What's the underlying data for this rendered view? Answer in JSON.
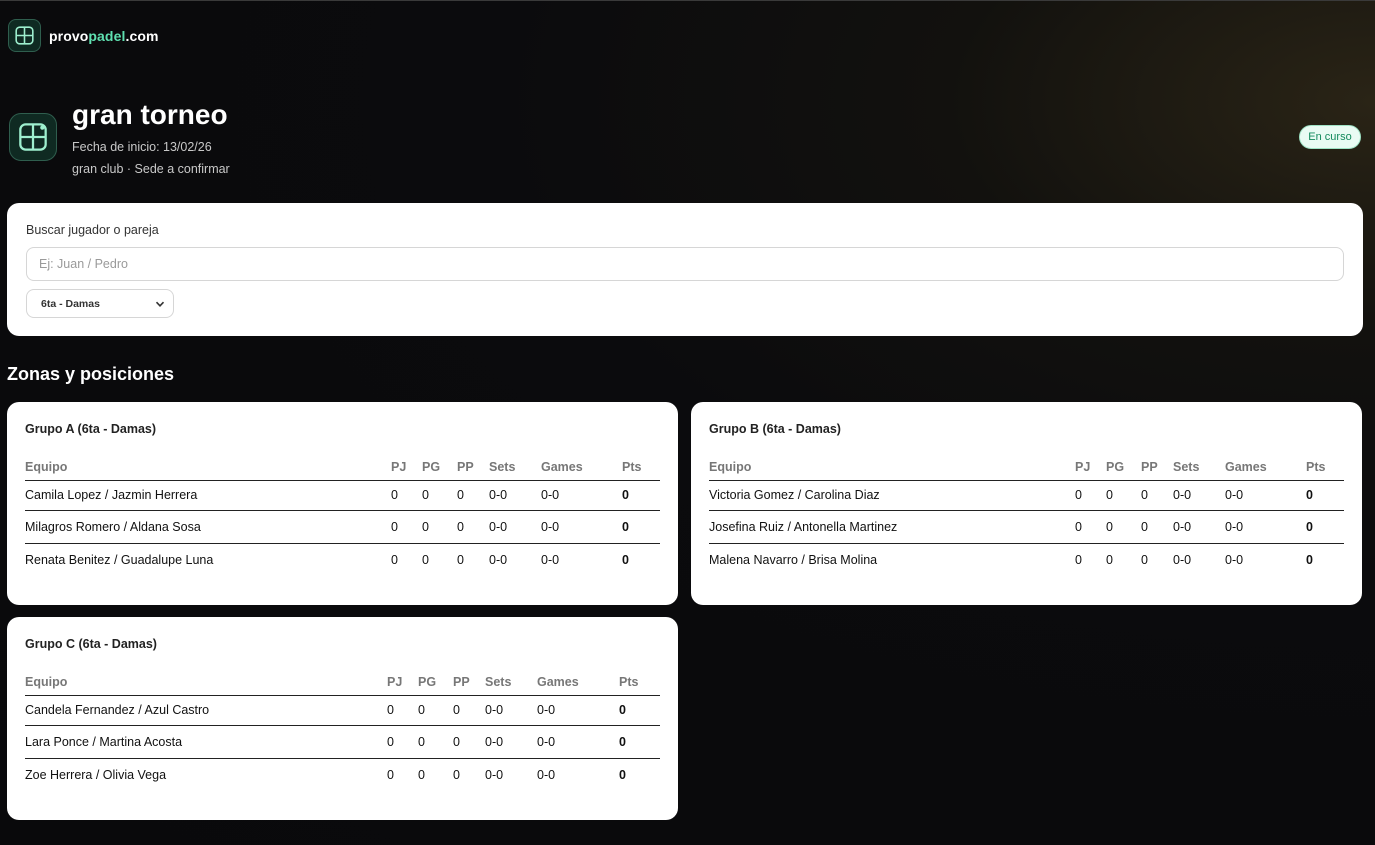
{
  "brand": {
    "prefix": "provo",
    "accent": "padel",
    "suffix": ".com"
  },
  "tournament": {
    "title": "gran torneo",
    "start_date": "Fecha de inicio: 13/02/26",
    "venue": "gran club · Sede a confirmar",
    "status": "En curso"
  },
  "filters": {
    "search_label": "Buscar jugador o pareja",
    "search_placeholder": "Ej: Juan / Pedro",
    "search_value": "",
    "category_selected": "6ta - Damas"
  },
  "section_title": "Zonas y posiciones",
  "table_headers": [
    "Equipo",
    "PJ",
    "PG",
    "PP",
    "Sets",
    "Games",
    "Pts"
  ],
  "groups": [
    {
      "title": "Grupo A (6ta - Damas)",
      "rows": [
        {
          "team": "Camila Lopez / Jazmin Herrera",
          "pj": "0",
          "pg": "0",
          "pp": "0",
          "sets": "0-0",
          "games": "0-0",
          "pts": "0"
        },
        {
          "team": "Milagros Romero / Aldana Sosa",
          "pj": "0",
          "pg": "0",
          "pp": "0",
          "sets": "0-0",
          "games": "0-0",
          "pts": "0"
        },
        {
          "team": "Renata Benitez / Guadalupe Luna",
          "pj": "0",
          "pg": "0",
          "pp": "0",
          "sets": "0-0",
          "games": "0-0",
          "pts": "0"
        }
      ]
    },
    {
      "title": "Grupo B (6ta - Damas)",
      "rows": [
        {
          "team": "Victoria Gomez / Carolina Diaz",
          "pj": "0",
          "pg": "0",
          "pp": "0",
          "sets": "0-0",
          "games": "0-0",
          "pts": "0"
        },
        {
          "team": "Josefina Ruiz / Antonella Martinez",
          "pj": "0",
          "pg": "0",
          "pp": "0",
          "sets": "0-0",
          "games": "0-0",
          "pts": "0"
        },
        {
          "team": "Malena Navarro / Brisa Molina",
          "pj": "0",
          "pg": "0",
          "pp": "0",
          "sets": "0-0",
          "games": "0-0",
          "pts": "0"
        }
      ]
    },
    {
      "title": "Grupo C (6ta - Damas)",
      "rows": [
        {
          "team": "Candela Fernandez / Azul Castro",
          "pj": "0",
          "pg": "0",
          "pp": "0",
          "sets": "0-0",
          "games": "0-0",
          "pts": "0"
        },
        {
          "team": "Lara Ponce / Martina Acosta",
          "pj": "0",
          "pg": "0",
          "pp": "0",
          "sets": "0-0",
          "games": "0-0",
          "pts": "0"
        },
        {
          "team": "Zoe Herrera / Olivia Vega",
          "pj": "0",
          "pg": "0",
          "pp": "0",
          "sets": "0-0",
          "games": "0-0",
          "pts": "0"
        }
      ]
    }
  ],
  "icons": {
    "logo": "padel-court-icon",
    "select_arrow": "chevron-down-icon"
  },
  "colors": {
    "accent": "#5fe0b0",
    "status_bg": "#e9fbf3",
    "status_text": "#138a5c"
  }
}
